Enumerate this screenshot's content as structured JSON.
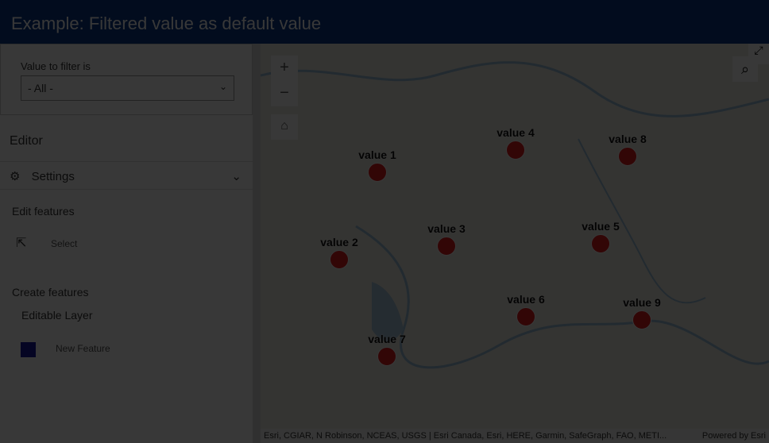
{
  "title": "Example: Filtered value as default value",
  "filter": {
    "label": "Value to filter is",
    "selected": "- All -"
  },
  "editor": {
    "title": "Editor",
    "settings": "Settings",
    "edit_features": "Edit features",
    "select": "Select",
    "create_features": "Create features",
    "layer": "Editable Layer",
    "new_feature": "New Feature",
    "feature_color": "#1a1aa0"
  },
  "map": {
    "zoom_in": "+",
    "zoom_out": "−",
    "home": "⌂",
    "points": [
      {
        "label": "value 1"
      },
      {
        "label": "value 2"
      },
      {
        "label": "value 3"
      },
      {
        "label": "value 4"
      },
      {
        "label": "value 5"
      },
      {
        "label": "value 6"
      },
      {
        "label": "value 7"
      },
      {
        "label": "value 8"
      },
      {
        "label": "value 9"
      }
    ],
    "attribution": "Esri, CGIAR, N Robinson, NCEAS, USGS | Esri Canada, Esri, HERE, Garmin, SafeGraph, FAO, METI...",
    "powered": "Powered by Esri"
  }
}
